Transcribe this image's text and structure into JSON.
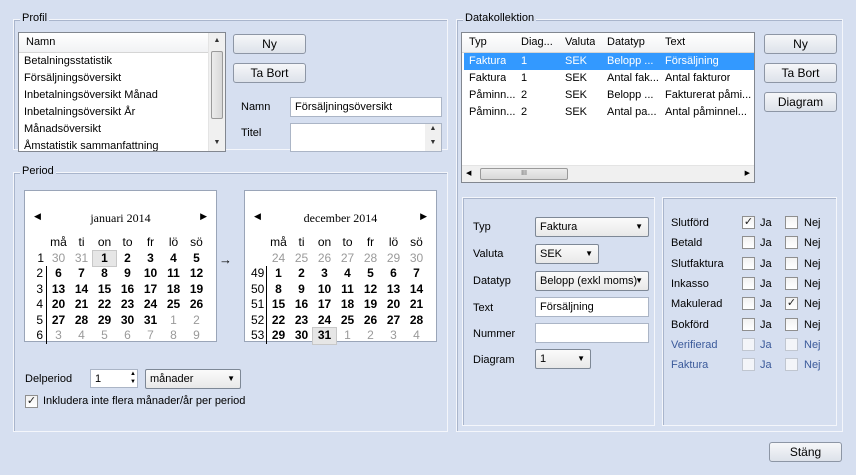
{
  "profil": {
    "title": "Profil",
    "list_header": "Namn",
    "items": [
      "Betalningsstatistik",
      "Försäljningsöversikt",
      "Inbetalningsöversikt Månad",
      "Inbetalningsöversikt År",
      "Månadsöversikt",
      "Åmstatistik sammanfattning"
    ],
    "btn_new": "Ny",
    "btn_delete": "Ta Bort",
    "name_label": "Namn",
    "name_value": "Försäljningsöversikt",
    "titel_label": "Titel",
    "titel_value": ""
  },
  "period": {
    "title": "Period",
    "arrow": "→",
    "cal_left": {
      "month": "januari 2014",
      "weekdays": [
        "må",
        "ti",
        "on",
        "to",
        "fr",
        "lö",
        "sö"
      ],
      "weeks": [
        "1",
        "2",
        "3",
        "4",
        "5",
        "6"
      ],
      "days": [
        [
          "30",
          "31",
          "1",
          "2",
          "3",
          "4",
          "5"
        ],
        [
          "6",
          "7",
          "8",
          "9",
          "10",
          "11",
          "12"
        ],
        [
          "13",
          "14",
          "15",
          "16",
          "17",
          "18",
          "19"
        ],
        [
          "20",
          "21",
          "22",
          "23",
          "24",
          "25",
          "26"
        ],
        [
          "27",
          "28",
          "29",
          "30",
          "31",
          "1",
          "2"
        ],
        [
          "3",
          "4",
          "5",
          "6",
          "7",
          "8",
          "9"
        ]
      ]
    },
    "cal_right": {
      "month": "december 2014",
      "weekdays": [
        "må",
        "ti",
        "on",
        "to",
        "fr",
        "lö",
        "sö"
      ],
      "weeks": [
        "",
        "49",
        "50",
        "51",
        "52",
        "53"
      ],
      "days": [
        [
          "24",
          "25",
          "26",
          "27",
          "28",
          "29",
          "30"
        ],
        [
          "1",
          "2",
          "3",
          "4",
          "5",
          "6",
          "7"
        ],
        [
          "8",
          "9",
          "10",
          "11",
          "12",
          "13",
          "14"
        ],
        [
          "15",
          "16",
          "17",
          "18",
          "19",
          "20",
          "21"
        ],
        [
          "22",
          "23",
          "24",
          "25",
          "26",
          "27",
          "28"
        ],
        [
          "29",
          "30",
          "31",
          "1",
          "2",
          "3",
          "4"
        ]
      ]
    },
    "delperiod_label": "Delperiod",
    "delperiod_value": "1",
    "unit_value": "månader",
    "include_label": "Inkludera inte flera månader/år per period",
    "include_checked": "✓"
  },
  "datakollektion": {
    "title": "Datakollektion",
    "columns": [
      "Typ",
      "Diag...",
      "Valuta",
      "Datatyp",
      "Text"
    ],
    "rows": [
      [
        "Faktura",
        "1",
        "SEK",
        "Belopp ...",
        "Försäljning"
      ],
      [
        "Faktura",
        "1",
        "SEK",
        "Antal fak...",
        "Antal fakturor"
      ],
      [
        "Påminn...",
        "2",
        "SEK",
        "Belopp ...",
        "Fakturerat påmi..."
      ],
      [
        "Påminn...",
        "2",
        "SEK",
        "Antal pa...",
        "Antal påminnel..."
      ]
    ],
    "btn_new": "Ny",
    "btn_delete": "Ta Bort",
    "btn_diagram": "Diagram",
    "scroll_grip": "III"
  },
  "detail": {
    "typ_label": "Typ",
    "typ_value": "Faktura",
    "valuta_label": "Valuta",
    "valuta_value": "SEK",
    "datatyp_label": "Datatyp",
    "datatyp_value": "Belopp (exkl moms)",
    "text_label": "Text",
    "text_value": "Försäljning",
    "nummer_label": "Nummer",
    "nummer_value": "",
    "diagram_label": "Diagram",
    "diagram_value": "1"
  },
  "filters": {
    "ja": "Ja",
    "nej": "Nej",
    "items": [
      {
        "label": "Slutförd",
        "ja": "✓",
        "nej": ""
      },
      {
        "label": "Betald",
        "ja": "",
        "nej": ""
      },
      {
        "label": "Slutfaktura",
        "ja": "",
        "nej": ""
      },
      {
        "label": "Inkasso",
        "ja": "",
        "nej": ""
      },
      {
        "label": "Makulerad",
        "ja": "",
        "nej": "✓"
      },
      {
        "label": "Bokförd",
        "ja": "",
        "nej": ""
      },
      {
        "label": "Verifierad",
        "ja": "",
        "nej": ""
      },
      {
        "label": "Faktura",
        "ja": "",
        "nej": ""
      }
    ]
  },
  "footer": {
    "close": "Stäng"
  }
}
